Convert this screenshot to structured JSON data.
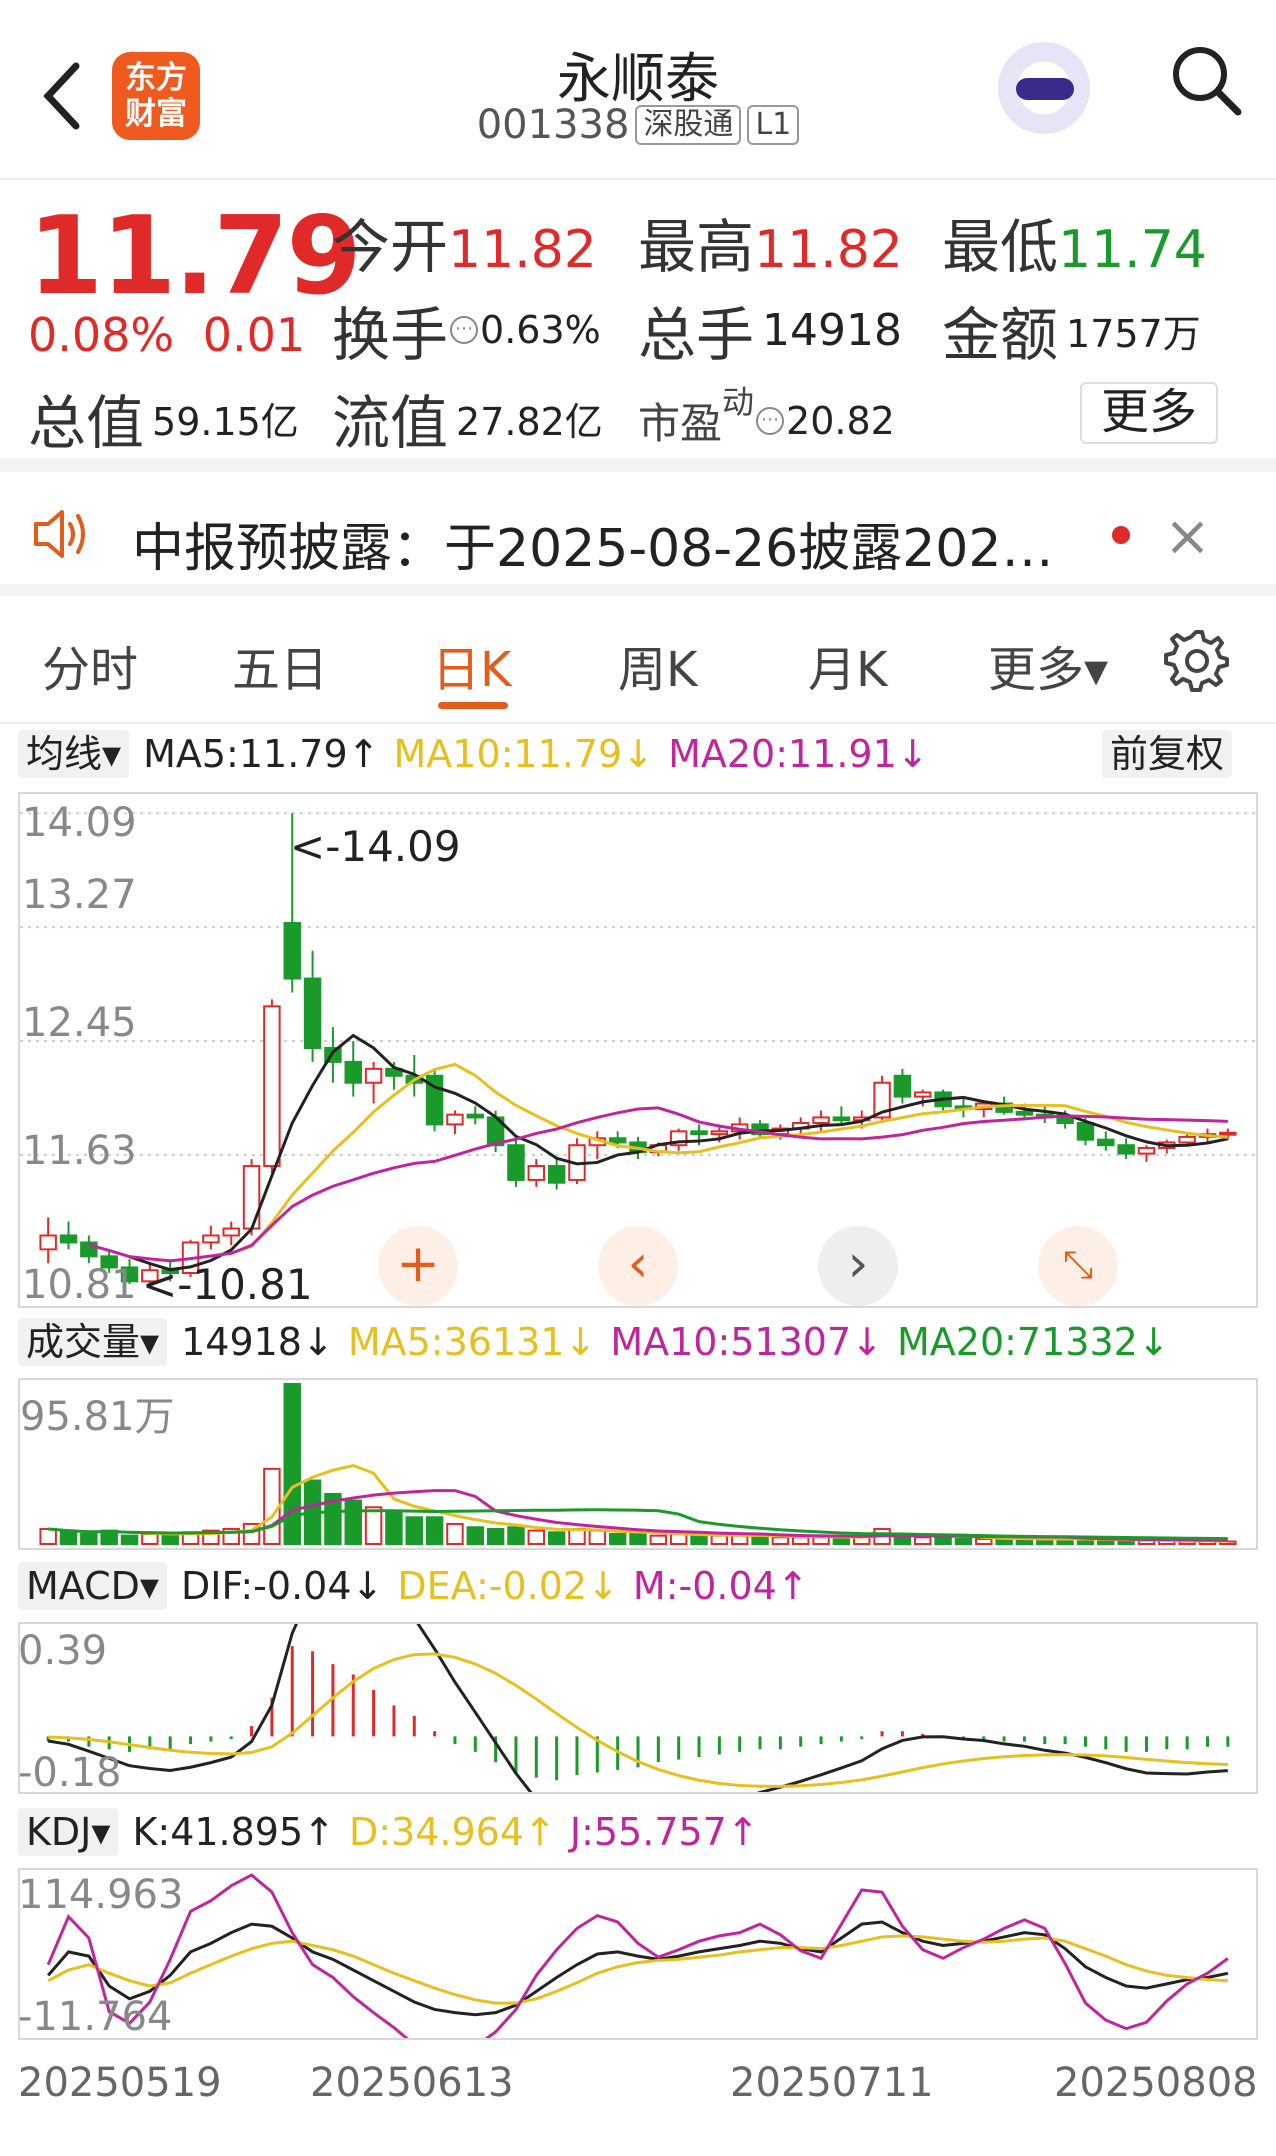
{
  "header": {
    "title": "永顺泰",
    "code": "001338",
    "tag1": "深股通",
    "tag2": "L1",
    "logo_line1": "东方",
    "logo_line2": "财富",
    "back_icon": "chevron-left-icon",
    "search_icon": "search-icon"
  },
  "quote": {
    "price": "11.79",
    "pct": "0.08%",
    "change": "0.01",
    "open_label": "今开",
    "open": "11.82",
    "high_label": "最高",
    "high": "11.82",
    "low_label": "最低",
    "low": "11.74",
    "turnover_label": "换手",
    "turnover": "0.63%",
    "volume_label": "总手",
    "volume": "14918",
    "amount_label": "金额",
    "amount": "1757万",
    "mcap_label": "总值",
    "mcap": "59.15亿",
    "float_label": "流值",
    "float": "27.82亿",
    "pe_label": "市盈",
    "pe_sup": "动",
    "pe": "20.82",
    "more": "更多"
  },
  "notice": {
    "text": "中报预披露：于2025-08-26披露202…",
    "close": "×"
  },
  "tabs": [
    "分时",
    "五日",
    "日K",
    "周K",
    "月K",
    "更多▾"
  ],
  "kline": {
    "dropdown": "均线",
    "ma5": "MA5:11.79↑",
    "ma10": "MA10:11.79↓",
    "ma20": "MA20:11.91↓",
    "adjust": "前复权",
    "y_labels": [
      "14.09",
      "13.27",
      "12.45",
      "11.63",
      "10.81"
    ],
    "max_label": "<-14.09",
    "min_label": "<-10.81"
  },
  "volume": {
    "dropdown": "成交量",
    "vol": "14918↓",
    "ma5": "MA5:36131↓",
    "ma10": "MA10:51307↓",
    "ma20": "MA20:71332↓",
    "y_label": "95.81万"
  },
  "macd": {
    "dropdown": "MACD",
    "dif": "DIF:-0.04↓",
    "dea": "DEA:-0.02↓",
    "m": "M:-0.04↑",
    "y_top": "0.39",
    "y_bottom": "-0.18"
  },
  "kdj": {
    "dropdown": "KDJ",
    "k": "K:41.895↑",
    "d": "D:34.964↑",
    "j": "J:55.757↑",
    "y_top": "114.963",
    "y_bottom": "-11.764"
  },
  "dates": [
    "20250519",
    "20250613",
    "20250711",
    "20250808"
  ],
  "colors": {
    "up": "#e02929",
    "down": "#1a9a2a",
    "ma5": "#222222",
    "ma10": "#e6c01e",
    "ma20": "#c0259c",
    "accent": "#e25c1c"
  },
  "chart_data": [
    {
      "type": "candlestick",
      "title": "日K",
      "ylim": [
        10.81,
        14.09
      ],
      "ohlc": [
        [
          10.95,
          11.18,
          10.85,
          11.05
        ],
        [
          11.05,
          11.15,
          10.95,
          11.0
        ],
        [
          11.0,
          11.05,
          10.85,
          10.9
        ],
        [
          10.9,
          10.95,
          10.78,
          10.82
        ],
        [
          10.82,
          10.88,
          10.7,
          10.72
        ],
        [
          10.72,
          10.85,
          10.68,
          10.8
        ],
        [
          10.8,
          10.88,
          10.72,
          10.78
        ],
        [
          10.78,
          11.02,
          10.75,
          11.0
        ],
        [
          11.0,
          11.12,
          10.95,
          11.05
        ],
        [
          11.05,
          11.15,
          10.98,
          11.1
        ],
        [
          11.1,
          11.6,
          11.05,
          11.55
        ],
        [
          11.55,
          12.75,
          11.5,
          12.7
        ],
        [
          13.3,
          14.09,
          12.8,
          12.9
        ],
        [
          12.9,
          13.1,
          12.3,
          12.4
        ],
        [
          12.4,
          12.55,
          12.15,
          12.3
        ],
        [
          12.3,
          12.45,
          12.05,
          12.15
        ],
        [
          12.15,
          12.3,
          12.0,
          12.25
        ],
        [
          12.25,
          12.3,
          12.1,
          12.2
        ],
        [
          12.2,
          12.35,
          12.05,
          12.15
        ],
        [
          12.2,
          12.25,
          11.8,
          11.85
        ],
        [
          11.85,
          11.95,
          11.78,
          11.92
        ],
        [
          11.92,
          11.98,
          11.85,
          11.9
        ],
        [
          11.9,
          11.95,
          11.65,
          11.7
        ],
        [
          11.7,
          11.75,
          11.4,
          11.45
        ],
        [
          11.45,
          11.6,
          11.4,
          11.55
        ],
        [
          11.55,
          11.6,
          11.38,
          11.43
        ],
        [
          11.45,
          11.75,
          11.42,
          11.7
        ],
        [
          11.7,
          11.8,
          11.6,
          11.75
        ],
        [
          11.75,
          11.8,
          11.68,
          11.72
        ],
        [
          11.72,
          11.76,
          11.6,
          11.65
        ],
        [
          11.65,
          11.72,
          11.62,
          11.7
        ],
        [
          11.7,
          11.82,
          11.66,
          11.8
        ],
        [
          11.8,
          11.85,
          11.7,
          11.78
        ],
        [
          11.78,
          11.85,
          11.72,
          11.8
        ],
        [
          11.8,
          11.9,
          11.74,
          11.85
        ],
        [
          11.85,
          11.88,
          11.76,
          11.78
        ],
        [
          11.78,
          11.85,
          11.74,
          11.82
        ],
        [
          11.82,
          11.9,
          11.78,
          11.86
        ],
        [
          11.86,
          11.95,
          11.8,
          11.9
        ],
        [
          11.9,
          11.98,
          11.84,
          11.88
        ],
        [
          11.88,
          11.95,
          11.82,
          11.9
        ],
        [
          11.9,
          12.2,
          11.86,
          12.15
        ],
        [
          12.2,
          12.25,
          12.0,
          12.05
        ],
        [
          12.05,
          12.1,
          11.98,
          12.08
        ],
        [
          12.08,
          12.1,
          11.94,
          11.98
        ],
        [
          11.98,
          12.05,
          11.9,
          11.96
        ],
        [
          11.96,
          12.02,
          11.9,
          12.0
        ],
        [
          12.0,
          12.05,
          11.92,
          11.94
        ],
        [
          11.94,
          12.0,
          11.88,
          11.92
        ],
        [
          11.92,
          11.98,
          11.86,
          11.9
        ],
        [
          11.9,
          11.95,
          11.82,
          11.86
        ],
        [
          11.86,
          11.9,
          11.7,
          11.74
        ],
        [
          11.74,
          11.8,
          11.66,
          11.7
        ],
        [
          11.7,
          11.75,
          11.6,
          11.64
        ],
        [
          11.64,
          11.7,
          11.58,
          11.68
        ],
        [
          11.68,
          11.74,
          11.64,
          11.72
        ],
        [
          11.72,
          11.78,
          11.7,
          11.76
        ],
        [
          11.76,
          11.82,
          11.72,
          11.78
        ],
        [
          11.78,
          11.82,
          11.74,
          11.79
        ]
      ]
    },
    {
      "type": "bar",
      "title": "成交量",
      "ylim": [
        0,
        95.81
      ],
      "unit": "万",
      "values": [
        9,
        7,
        6,
        8,
        5,
        6,
        5,
        7,
        8,
        9,
        12,
        45,
        95.81,
        38,
        30,
        26,
        22,
        19,
        16,
        16,
        12,
        10,
        9,
        10,
        8,
        7,
        9,
        8,
        6,
        6,
        5,
        6,
        5,
        5,
        5,
        5,
        4,
        4,
        4,
        4,
        4,
        9,
        6,
        4,
        4,
        3,
        3,
        3,
        3,
        3,
        3,
        3,
        2,
        2,
        2,
        2,
        1.5,
        1.5,
        1.49
      ]
    },
    {
      "type": "bar",
      "title": "MACD",
      "ylim": [
        -0.18,
        0.39
      ],
      "values": [
        -0.02,
        -0.02,
        -0.04,
        -0.05,
        -0.06,
        -0.05,
        -0.05,
        -0.03,
        -0.02,
        -0.01,
        0.04,
        0.15,
        0.35,
        0.33,
        0.28,
        0.24,
        0.18,
        0.12,
        0.08,
        0.02,
        -0.03,
        -0.06,
        -0.1,
        -0.14,
        -0.16,
        -0.17,
        -0.15,
        -0.14,
        -0.13,
        -0.12,
        -0.1,
        -0.09,
        -0.08,
        -0.07,
        -0.06,
        -0.05,
        -0.05,
        -0.04,
        -0.03,
        -0.02,
        -0.01,
        0.02,
        0.02,
        0.01,
        0.0,
        -0.01,
        -0.01,
        -0.02,
        -0.02,
        -0.03,
        -0.03,
        -0.04,
        -0.05,
        -0.06,
        -0.06,
        -0.05,
        -0.05,
        -0.04,
        -0.04
      ]
    },
    {
      "type": "line",
      "title": "KDJ",
      "ylim": [
        -11.764,
        114.963
      ],
      "series": [
        {
          "name": "K",
          "values": [
            40,
            62,
            58,
            30,
            18,
            25,
            40,
            62,
            70,
            80,
            88,
            86,
            75,
            62,
            55,
            45,
            35,
            25,
            15,
            8,
            5,
            3,
            5,
            12,
            25,
            38,
            50,
            60,
            62,
            58,
            55,
            58,
            62,
            65,
            68,
            72,
            70,
            65,
            62,
            75,
            88,
            90,
            80,
            72,
            68,
            70,
            72,
            76,
            80,
            78,
            65,
            48,
            38,
            30,
            28,
            32,
            36,
            38,
            41.895
          ]
        },
        {
          "name": "D",
          "values": [
            35,
            45,
            50,
            42,
            35,
            30,
            33,
            42,
            50,
            58,
            65,
            70,
            72,
            68,
            64,
            58,
            50,
            42,
            35,
            28,
            22,
            17,
            14,
            14,
            18,
            25,
            33,
            42,
            48,
            52,
            54,
            55,
            57,
            59,
            62,
            64,
            66,
            66,
            65,
            68,
            72,
            76,
            77,
            76,
            74,
            72,
            71,
            72,
            74,
            75,
            72,
            65,
            58,
            50,
            44,
            40,
            38,
            36,
            34.964
          ]
        },
        {
          "name": "J",
          "values": [
            50,
            95,
            75,
            6,
            -5,
            15,
            55,
            100,
            110,
            124,
            134,
            118,
            80,
            50,
            38,
            20,
            5,
            -9,
            -25,
            -30,
            -30,
            -27,
            -13,
            8,
            40,
            64,
            84,
            96,
            90,
            70,
            57,
            64,
            72,
            77,
            80,
            88,
            78,
            63,
            56,
            88,
            120,
            118,
            86,
            64,
            56,
            66,
            74,
            84,
            92,
            84,
            51,
            14,
            -2,
            -10,
            -4,
            16,
            32,
            42,
            55.757
          ]
        }
      ]
    }
  ]
}
